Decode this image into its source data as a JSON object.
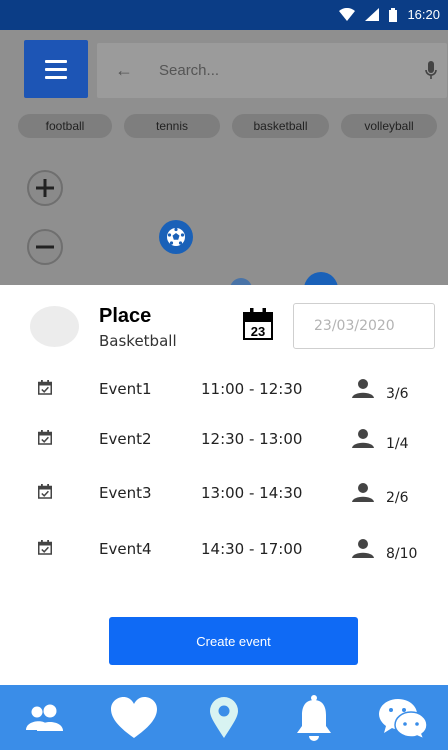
{
  "status_bar": {
    "time": "16:20"
  },
  "search": {
    "placeholder": "Search..."
  },
  "chips": [
    "football",
    "tennis",
    "basketball",
    "volleyball"
  ],
  "place": {
    "name": "Place",
    "sport": "Basketball"
  },
  "calendar": {
    "day": "23"
  },
  "date_field": {
    "value": "23/03/2020"
  },
  "events": [
    {
      "name": "Event1",
      "time": "11:00 - 12:30",
      "count": "3/6"
    },
    {
      "name": "Event2",
      "time": "12:30 - 13:00",
      "count": "1/4"
    },
    {
      "name": "Event3",
      "time": "13:00 - 14:30",
      "count": "2/6"
    },
    {
      "name": "Event4",
      "time": "14:30 - 17:00",
      "count": "8/10"
    }
  ],
  "create_button": {
    "label": "Create event"
  },
  "colors": {
    "status_bar": "#0b3d86",
    "menu_button": "#1d55b5",
    "primary_button": "#0f6af5",
    "bottom_nav": "#3a8de8",
    "marker": "#1a61b8"
  },
  "nav": [
    "people-icon",
    "heart-icon",
    "location-pin-icon",
    "bell-icon",
    "chat-bubbles-icon"
  ]
}
